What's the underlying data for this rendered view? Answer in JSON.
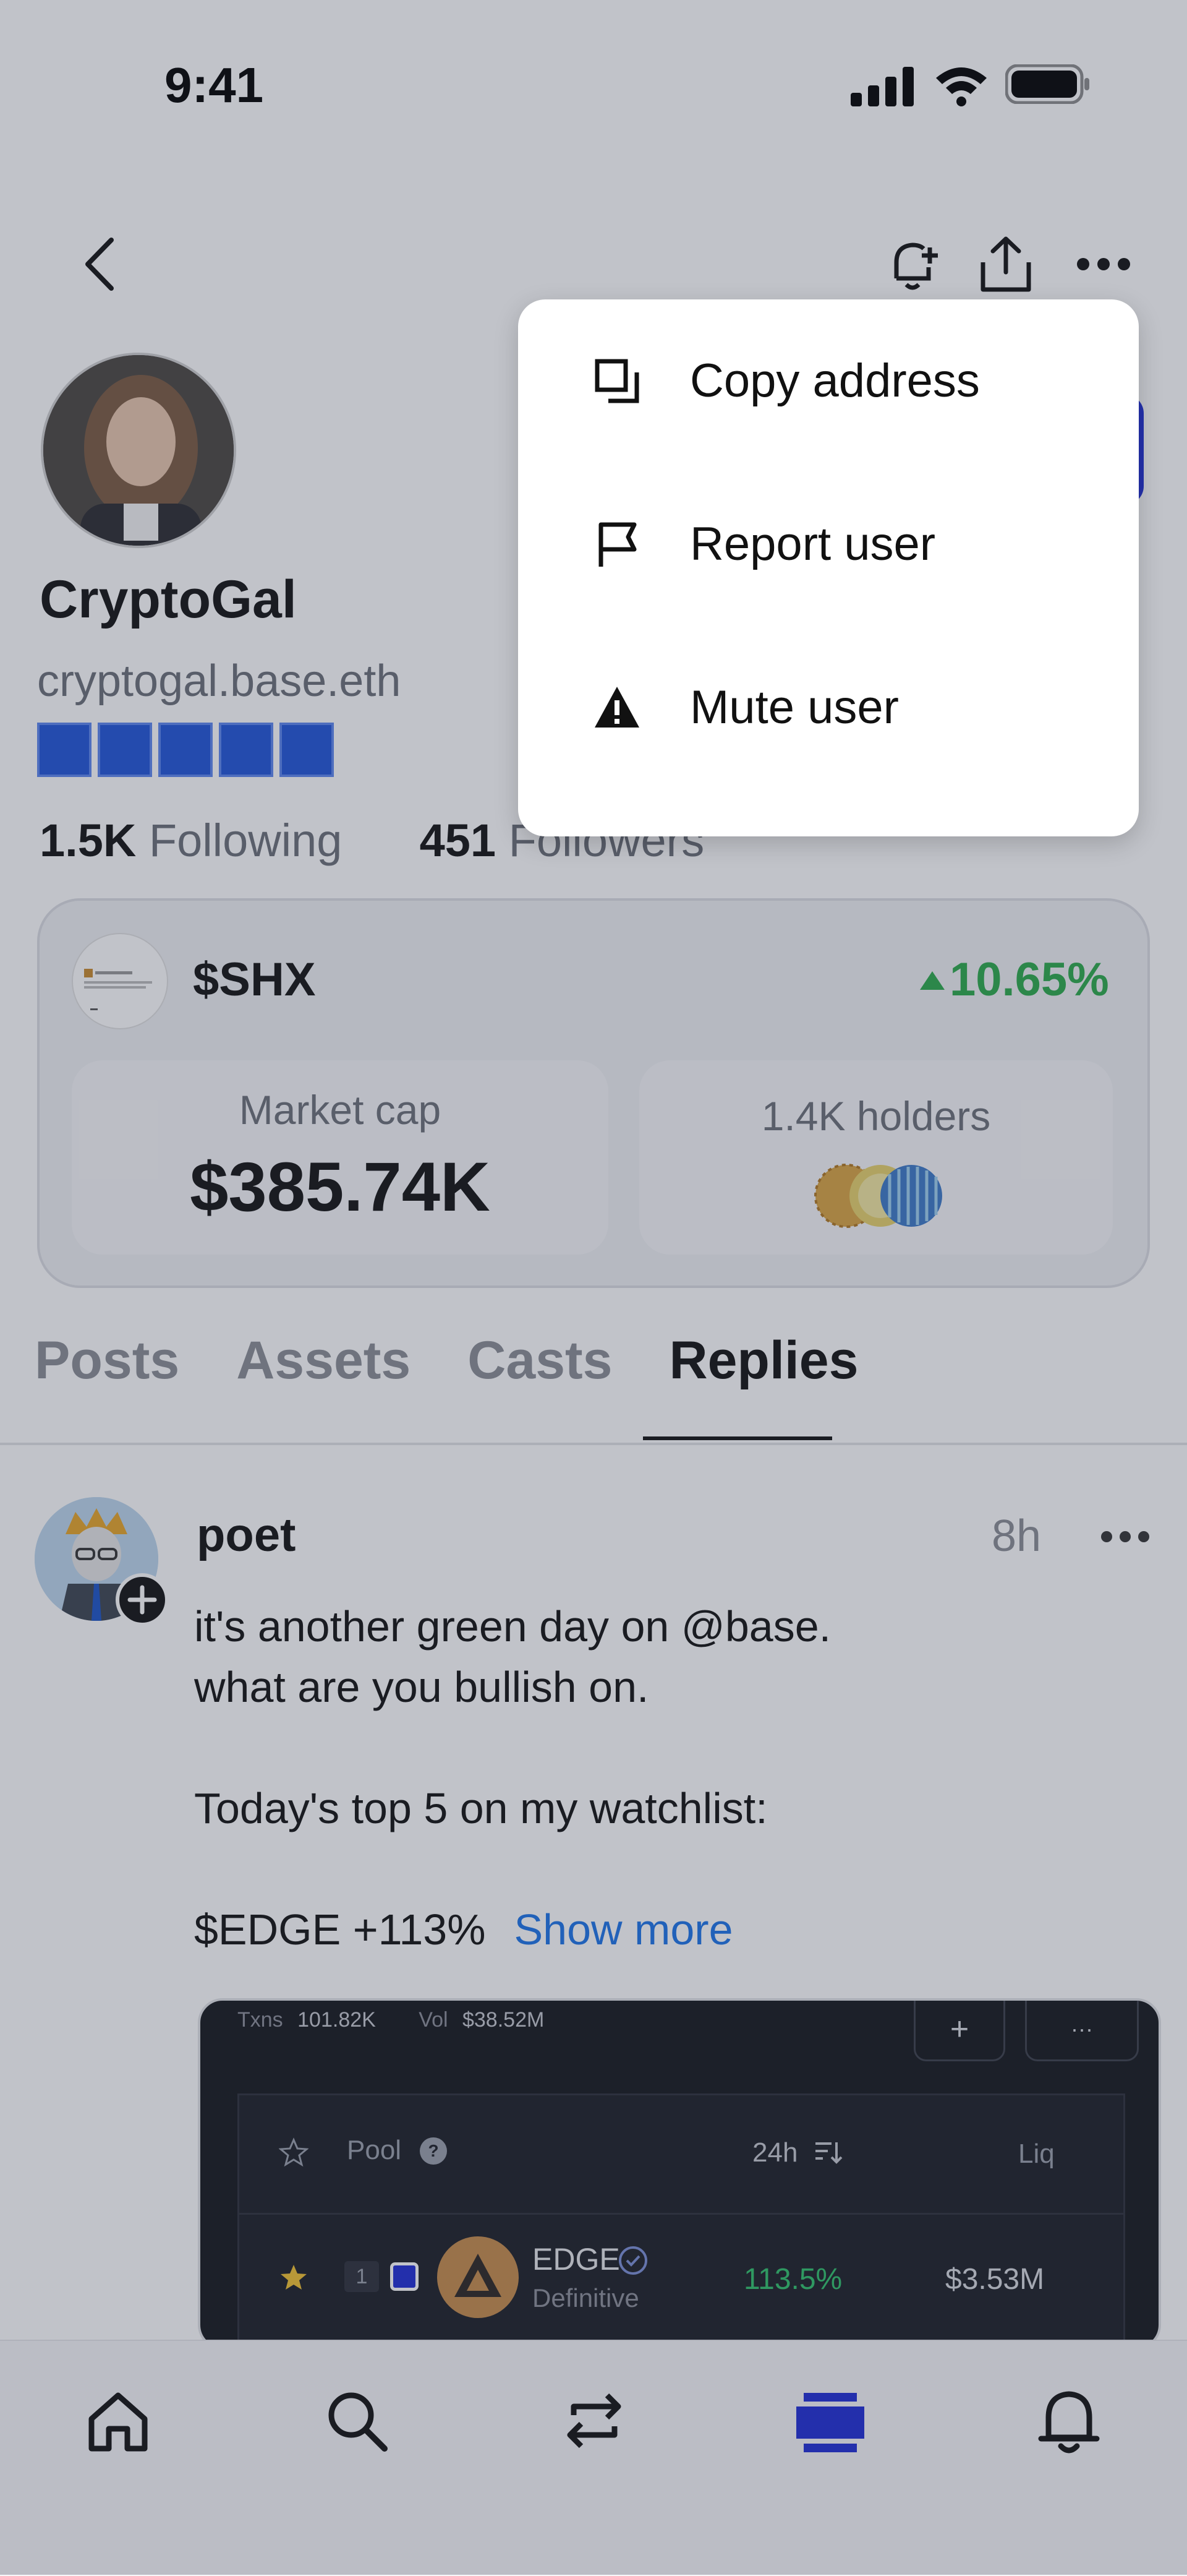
{
  "status_bar": {
    "time": "9:41"
  },
  "profile": {
    "name": "CryptoGal",
    "handle": "cryptogal.base.eth",
    "following_count": "1.5K",
    "following_label": "Following",
    "followers_count": "451",
    "followers_label": "Followers"
  },
  "token": {
    "symbol": "$SHX",
    "change": "10.65%",
    "market_cap_label": "Market cap",
    "market_cap_value": "$385.74K",
    "holders_label": "1.4K holders"
  },
  "tabs": [
    "Posts",
    "Assets",
    "Casts",
    "Replies"
  ],
  "active_tab": "Replies",
  "post": {
    "author": "poet",
    "time": "8h",
    "line1": "it's another green day on @base.",
    "line2": "what are you bullish on.",
    "line3": "Today's top 5 on my watchlist:",
    "line4": "$EDGE +113%",
    "show_more": "Show more"
  },
  "embed": {
    "txns_label": "Txns",
    "txns_value": "101.82K",
    "vol_label": "Vol",
    "vol_value": "$38.52M",
    "col_pool": "Pool",
    "col_24h": "24h",
    "col_liq": "Liq",
    "row_rank": "1",
    "row_name": "EDGE",
    "row_sub": "Definitive",
    "row_change": "113.5%",
    "row_liq": "$3.53M",
    "plus": "+",
    "more": "···"
  },
  "menu": {
    "items": [
      {
        "label": "Copy address",
        "icon": "copy-icon"
      },
      {
        "label": "Report user",
        "icon": "flag-icon"
      },
      {
        "label": "Mute user",
        "icon": "warning-icon"
      }
    ]
  },
  "colors": {
    "accent": "#1f54d8",
    "positive": "#2aa94a",
    "link": "#1a73e8"
  }
}
